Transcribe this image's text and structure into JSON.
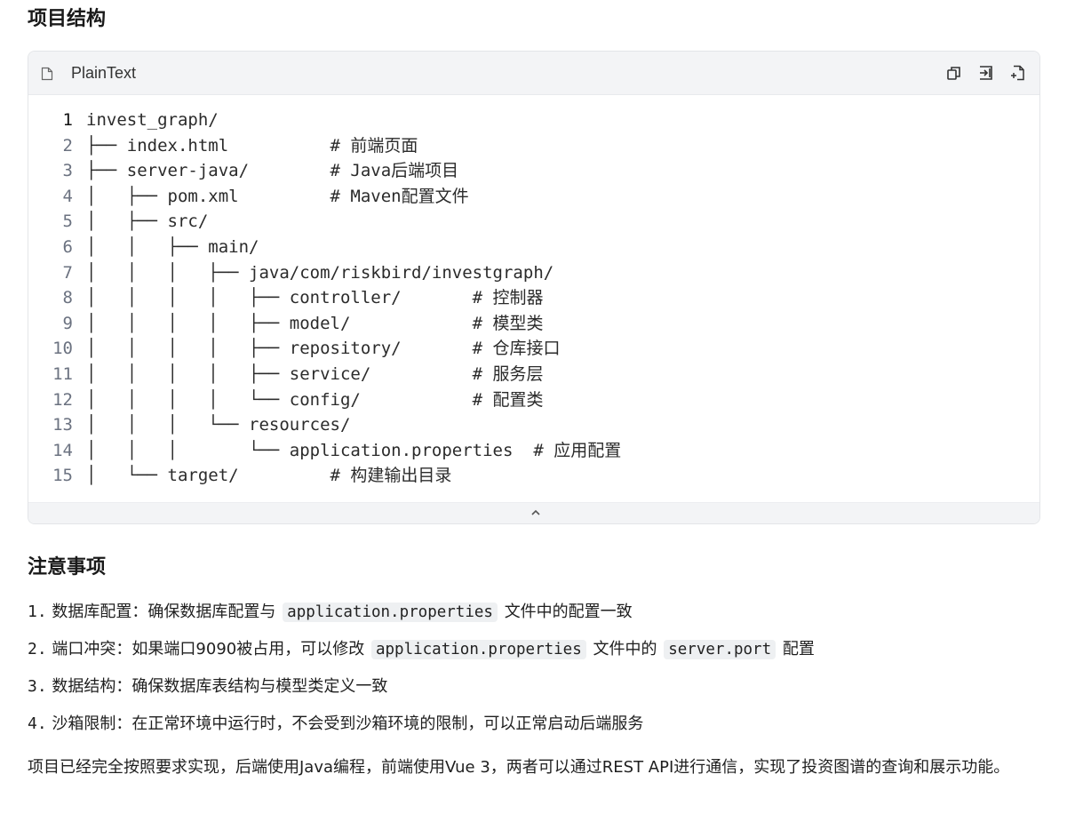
{
  "sections": {
    "structure_title": "项目结构",
    "notes_title": "注意事项"
  },
  "code_block": {
    "language": "PlainText",
    "header_icons": [
      "copy-icon",
      "insert-icon",
      "export-icon"
    ],
    "lines": [
      {
        "no": "1",
        "text": "invest_graph/"
      },
      {
        "no": "2",
        "text": "├── index.html          # 前端页面"
      },
      {
        "no": "3",
        "text": "├── server-java/        # Java后端项目"
      },
      {
        "no": "4",
        "text": "│   ├── pom.xml         # Maven配置文件"
      },
      {
        "no": "5",
        "text": "│   ├── src/"
      },
      {
        "no": "6",
        "text": "│   │   ├── main/"
      },
      {
        "no": "7",
        "text": "│   │   │   ├── java/com/riskbird/investgraph/"
      },
      {
        "no": "8",
        "text": "│   │   │   │   ├── controller/       # 控制器"
      },
      {
        "no": "9",
        "text": "│   │   │   │   ├── model/            # 模型类"
      },
      {
        "no": "10",
        "text": "│   │   │   │   ├── repository/       # 仓库接口"
      },
      {
        "no": "11",
        "text": "│   │   │   │   ├── service/          # 服务层"
      },
      {
        "no": "12",
        "text": "│   │   │   │   └── config/           # 配置类"
      },
      {
        "no": "13",
        "text": "│   │   │   └── resources/"
      },
      {
        "no": "14",
        "text": "│   │   │       └── application.properties  # 应用配置"
      },
      {
        "no": "15",
        "text": "│   └── target/         # 构建输出目录"
      }
    ]
  },
  "notes": [
    {
      "num": "1.",
      "parts": [
        "数据库配置：确保数据库配置与",
        "application.properties",
        "文件中的配置一致"
      ]
    },
    {
      "num": "2.",
      "parts": [
        "端口冲突：如果端口9090被占用，可以修改",
        "application.properties",
        "文件中的",
        "server.port",
        "配置"
      ]
    },
    {
      "num": "3.",
      "parts": [
        "数据结构：确保数据库表结构与模型类定义一致"
      ]
    },
    {
      "num": "4.",
      "parts": [
        "沙箱限制：在正常环境中运行时，不会受到沙箱环境的限制，可以正常启动后端服务"
      ]
    }
  ],
  "summary": "项目已经完全按照要求实现，后端使用Java编程，前端使用Vue 3，两者可以通过REST API进行通信，实现了投资图谱的查询和展示功能。"
}
